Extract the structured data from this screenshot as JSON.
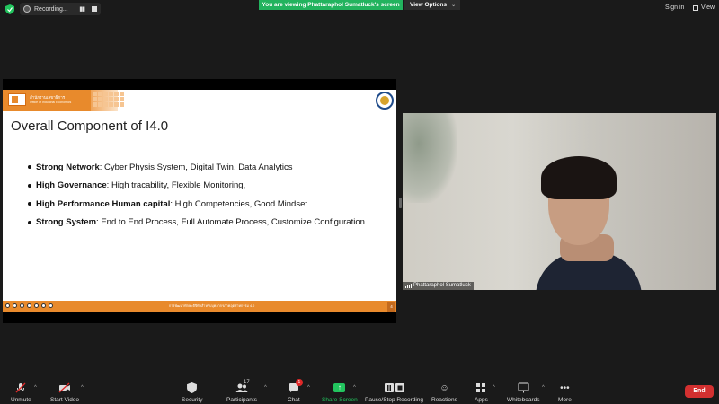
{
  "recording": {
    "label": "Recording..."
  },
  "banner": {
    "text": "You are viewing Phattaraphol Sumatluck's screen"
  },
  "view_options": {
    "label": "View Options"
  },
  "header_right": {
    "signin": "Sign in",
    "view": "View"
  },
  "slide": {
    "title": "Overall Component of I4.0",
    "header_line1": "สำนักงานเลขาธิการ",
    "header_line2": "Office of Industrial Economics",
    "bullets": [
      {
        "strong": "Strong Network",
        "rest": ": Cyber Physis System, Digital Twin, Data Analytics"
      },
      {
        "strong": "High Governance",
        "rest": ": High tracability, Flexible Monitoring,"
      },
      {
        "strong": "High Performance Human capital",
        "rest": ": High Competencies, Good Mindset"
      },
      {
        "strong": "Strong System",
        "rest": ": End to End Process, Full Automate Process, Customize Configuration"
      }
    ],
    "footer_text": "การพัฒนาทักษะดิจิทัลสำหรับบุคลากรภาคอุตสาหกรรม 4.0",
    "page_number": "4"
  },
  "video": {
    "participant_name": "Phattaraphol Sumatluck"
  },
  "toolbar": {
    "unmute": "Unmute",
    "start_video": "Start Video",
    "security": "Security",
    "participants": "Participants",
    "participants_count": "17",
    "chat": "Chat",
    "chat_badge": "1",
    "share_screen": "Share Screen",
    "record": "Pause/Stop Recording",
    "reactions": "Reactions",
    "apps": "Apps",
    "whiteboards": "Whiteboards",
    "more": "More",
    "end": "End"
  },
  "colors": {
    "slide_accent": "#e88a2c",
    "share_green": "#22b35e",
    "end_red": "#d33030"
  }
}
